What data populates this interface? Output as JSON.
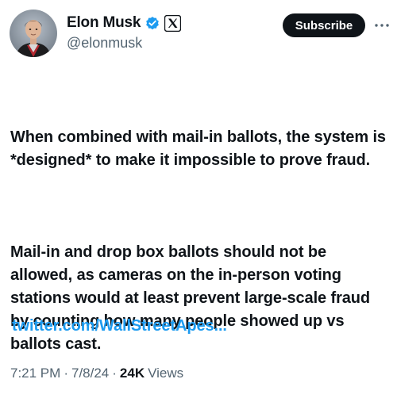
{
  "author": {
    "display_name": "Elon Musk",
    "handle": "@elonmusk",
    "verified_color": "#1d9bf0"
  },
  "header": {
    "subscribe_label": "Subscribe"
  },
  "tweet": {
    "paragraphs": [
      "When combined with mail-in ballots, the system is *designed* to make it impossible to prove fraud.",
      "Mail-in and drop box ballots should not be allowed, as cameras on the in-person voting stations would at least prevent large-scale fraud by counting how many people showed up vs ballots cast."
    ],
    "link_text": "twitter.com/WallStreetApes..."
  },
  "meta": {
    "time": "7:21 PM",
    "date": "7/8/24",
    "separator": "·",
    "views_count": "24K",
    "views_label": "Views"
  },
  "icons": {
    "verified": "verified-badge-icon",
    "affiliate": "x-logo-icon",
    "more": "more-dots-icon"
  },
  "colors": {
    "link": "#1d9bf0",
    "secondary_text": "#536471",
    "primary_text": "#0f1419"
  }
}
